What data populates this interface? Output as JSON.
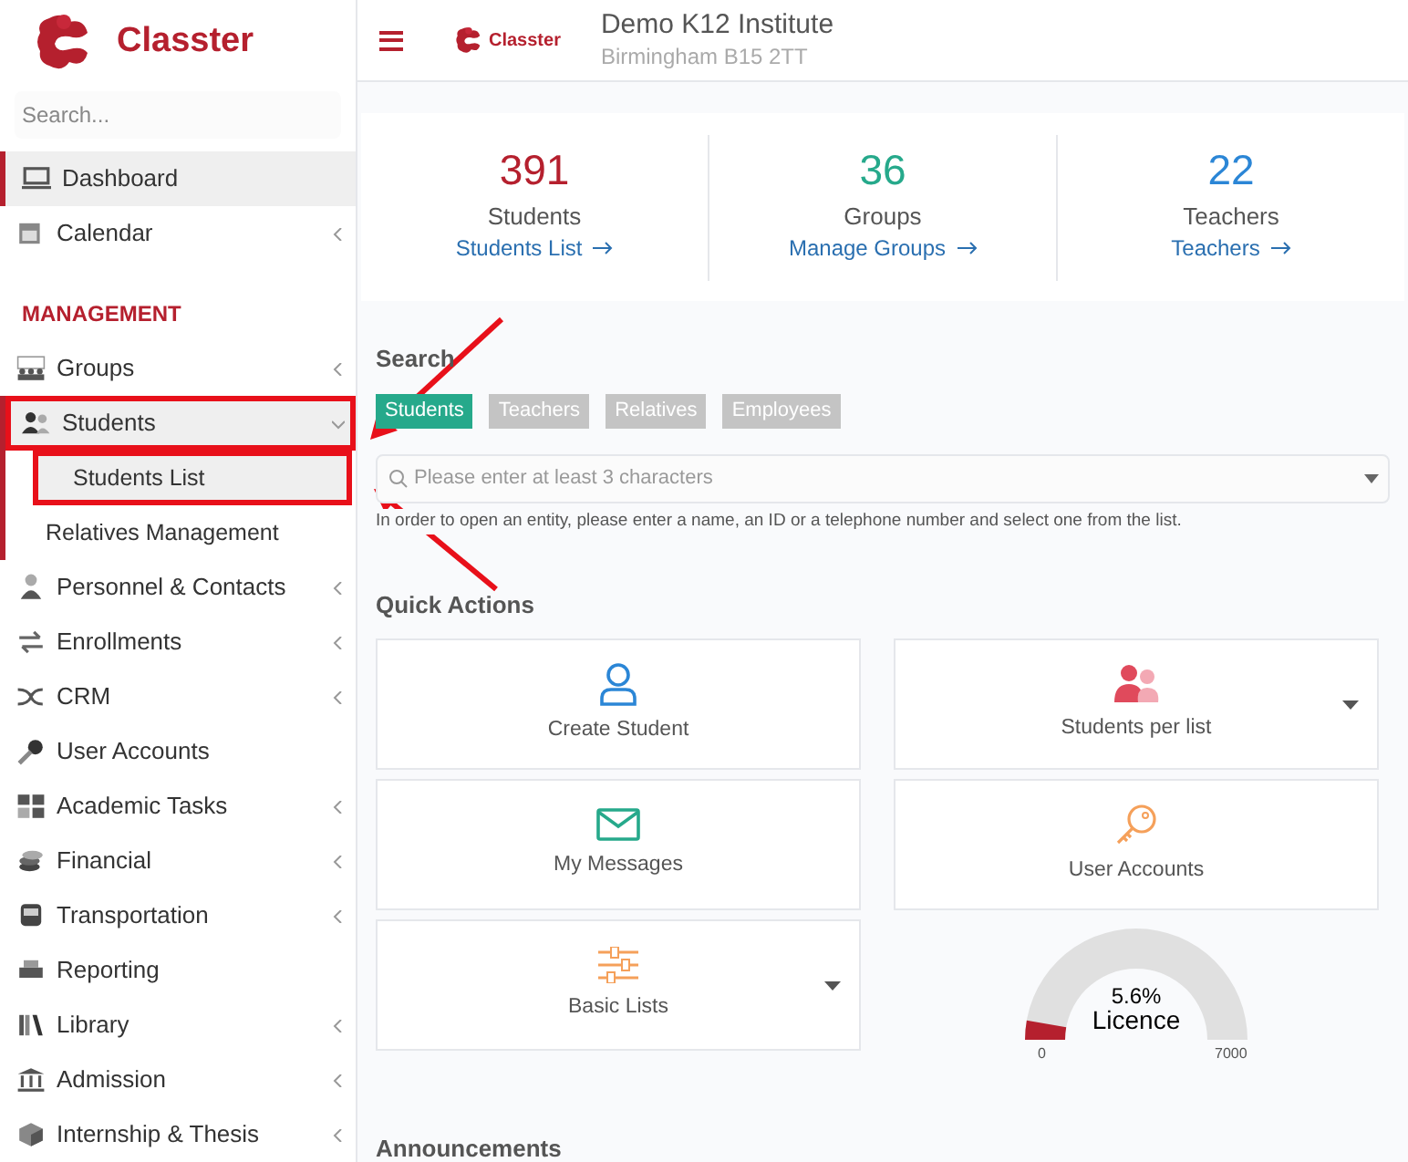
{
  "brand": {
    "name": "Classter"
  },
  "sidebar": {
    "search": {
      "placeholder": "Search..."
    },
    "items": [
      {
        "label": "Dashboard",
        "selected": true,
        "expandable": false
      },
      {
        "label": "Calendar",
        "selected": false,
        "expandable": true
      },
      {
        "kind": "heading",
        "label": "MANAGEMENT"
      },
      {
        "label": "Groups",
        "selected": false,
        "expandable": true
      },
      {
        "label": "Students",
        "selected": false,
        "expandable": true,
        "expanded": true,
        "highlighted": true,
        "children": [
          {
            "label": "Students List",
            "selected": true,
            "highlighted": true
          },
          {
            "label": "Relatives Management",
            "selected": false,
            "highlighted": false
          }
        ]
      },
      {
        "label": "Personnel & Contacts",
        "selected": false,
        "expandable": true
      },
      {
        "label": "Enrollments",
        "selected": false,
        "expandable": true
      },
      {
        "label": "CRM",
        "selected": false,
        "expandable": true
      },
      {
        "label": "User Accounts",
        "selected": false,
        "expandable": false
      },
      {
        "label": "Academic Tasks",
        "selected": false,
        "expandable": true
      },
      {
        "label": "Financial",
        "selected": false,
        "expandable": true
      },
      {
        "label": "Transportation",
        "selected": false,
        "expandable": true
      },
      {
        "label": "Reporting",
        "selected": false,
        "expandable": false
      },
      {
        "label": "Library",
        "selected": false,
        "expandable": true
      },
      {
        "label": "Admission",
        "selected": false,
        "expandable": true
      },
      {
        "label": "Internship & Thesis",
        "selected": false,
        "expandable": true
      }
    ]
  },
  "header": {
    "logo_text": "Classter",
    "institute": "Demo K12 Institute",
    "address": "Birmingham B15 2TT"
  },
  "stats": [
    {
      "count": "391",
      "label": "Students",
      "link": "Students List",
      "color": "#b5202e"
    },
    {
      "count": "36",
      "label": "Groups",
      "link": "Manage Groups",
      "color": "#26a98b"
    },
    {
      "count": "22",
      "label": "Teachers",
      "link": "Teachers",
      "color": "#2b86d6"
    }
  ],
  "search": {
    "title": "Search",
    "tabs": [
      {
        "label": "Students",
        "selected": true
      },
      {
        "label": "Teachers",
        "selected": false
      },
      {
        "label": "Relatives",
        "selected": false
      },
      {
        "label": "Employees",
        "selected": false
      }
    ],
    "placeholder": "Please enter at least 3 characters",
    "help": "In order to open an entity, please enter a name, an ID or a telephone number and select one from the list."
  },
  "quick_actions": {
    "title": "Quick Actions",
    "cards": [
      {
        "label": "Create Student",
        "dropdown": false
      },
      {
        "label": "Students per list",
        "dropdown": true
      },
      {
        "label": "My Messages",
        "dropdown": false
      },
      {
        "label": "User Accounts",
        "dropdown": false
      },
      {
        "label": "Basic Lists",
        "dropdown": true
      }
    ]
  },
  "licence": {
    "level": 0.056,
    "percent": "5.6%",
    "label": "Licence",
    "min": "0",
    "max": "7000"
  },
  "announcements": {
    "title": "Announcements"
  }
}
